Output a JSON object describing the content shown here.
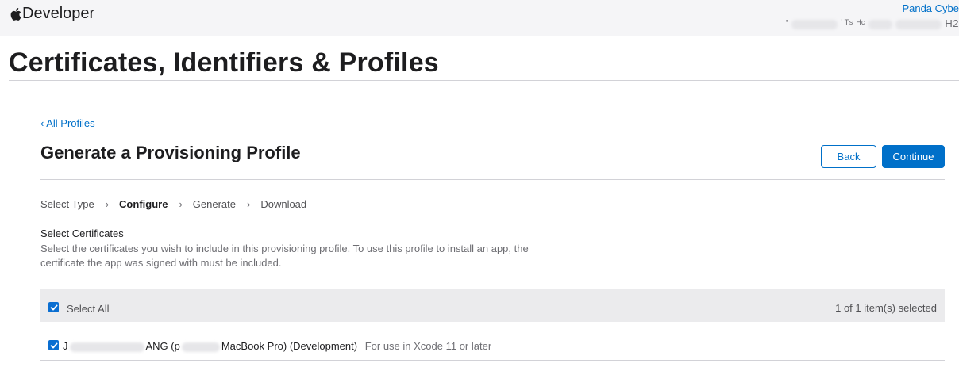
{
  "header": {
    "brand": "Developer",
    "account_name": "Panda Cybe",
    "team_fragment_1": "’",
    "team_fragment_2": "˙ᵀˢ ᴴᶜ",
    "team_fragment_3": "H2"
  },
  "page": {
    "title": "Certificates, Identifiers & Profiles"
  },
  "section": {
    "back_link": "‹ All Profiles",
    "title": "Generate a Provisioning Profile",
    "back_button": "Back",
    "continue_button": "Continue"
  },
  "steps": [
    {
      "label": "Select Type",
      "active": false
    },
    {
      "label": "Configure",
      "active": true
    },
    {
      "label": "Generate",
      "active": false
    },
    {
      "label": "Download",
      "active": false
    }
  ],
  "step_separator": "›",
  "certificates": {
    "heading": "Select Certificates",
    "description": "Select the certificates you wish to include in this provisioning profile. To use this profile to install an app, the certificate the app was signed with must be included.",
    "select_all_label": "Select All",
    "select_all_checked": true,
    "selected_count": "1 of 1 item(s) selected",
    "rows": [
      {
        "checked": true,
        "name_prefix": "J",
        "name_middle": "ANG (p",
        "name_suffix": "MacBook Pro) (Development)",
        "note": "For use in Xcode 11 or later"
      }
    ]
  },
  "colors": {
    "accent": "#0070c9",
    "checkbox": "#0a6ed1",
    "topbar": "#f5f5f7",
    "select_all_bar": "#ebebed"
  },
  "icons": {
    "brand": "apple-logo-icon",
    "checkbox": "checkmark-icon"
  }
}
